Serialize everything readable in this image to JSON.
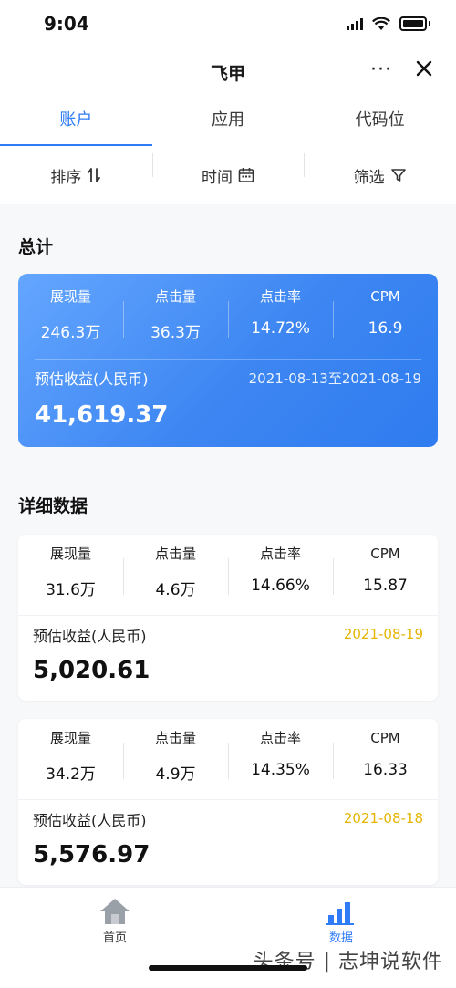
{
  "status": {
    "time": "9:04"
  },
  "nav": {
    "title": "飞甲",
    "more": "···"
  },
  "tabs": [
    {
      "label": "账户"
    },
    {
      "label": "应用"
    },
    {
      "label": "代码位"
    }
  ],
  "filters": {
    "sort": "排序",
    "time": "时间",
    "filter": "筛选"
  },
  "summary": {
    "title": "总计",
    "metrics": [
      {
        "label": "展现量",
        "value": "246.3万"
      },
      {
        "label": "点击量",
        "value": "36.3万"
      },
      {
        "label": "点击率",
        "value": "14.72%"
      },
      {
        "label": "CPM",
        "value": "16.9"
      }
    ],
    "revenue_label": "预估收益(人民币)",
    "date_range": "2021-08-13至2021-08-19",
    "revenue": "41,619.37"
  },
  "details": {
    "title": "详细数据",
    "items": [
      {
        "metrics": [
          {
            "label": "展现量",
            "value": "31.6万"
          },
          {
            "label": "点击量",
            "value": "4.6万"
          },
          {
            "label": "点击率",
            "value": "14.66%"
          },
          {
            "label": "CPM",
            "value": "15.87"
          }
        ],
        "revenue_label": "预估收益(人民币)",
        "date": "2021-08-19",
        "revenue": "5,020.61"
      },
      {
        "metrics": [
          {
            "label": "展现量",
            "value": "34.2万"
          },
          {
            "label": "点击量",
            "value": "4.9万"
          },
          {
            "label": "点击率",
            "value": "14.35%"
          },
          {
            "label": "CPM",
            "value": "16.33"
          }
        ],
        "revenue_label": "预估收益(人民币)",
        "date": "2021-08-18",
        "revenue": "5,576.97"
      }
    ]
  },
  "bottom_nav": [
    {
      "label": "首页",
      "icon": "home-icon"
    },
    {
      "label": "数据",
      "icon": "bar-chart-icon"
    }
  ],
  "watermark": "头条号 | 志坤说软件",
  "colors": {
    "accent": "#2f7cf6",
    "date_yellow": "#e5b500",
    "card_gradient_start": "#64a6ff",
    "card_gradient_end": "#2f7cf0"
  }
}
